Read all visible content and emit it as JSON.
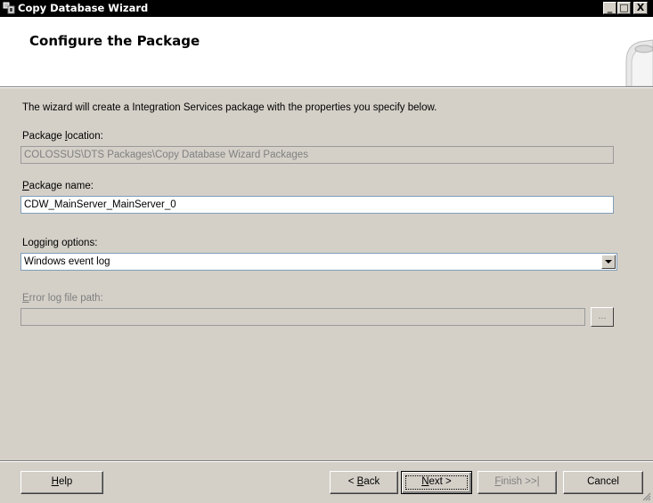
{
  "window": {
    "title": "Copy Database Wizard"
  },
  "caption_buttons": {
    "minimize": "_",
    "maximize": "□",
    "close": "X"
  },
  "header": {
    "title": "Configure the Package"
  },
  "intro": "The wizard will create a Integration Services package with the properties you specify below.",
  "package_location": {
    "label_pre": "Package ",
    "label_key": "l",
    "label_post": "ocation:",
    "value": "COLOSSUS\\DTS Packages\\Copy Database Wizard Packages"
  },
  "package_name": {
    "label_key": "P",
    "label_post": "ackage name:",
    "value": "CDW_MainServer_MainServer_0"
  },
  "logging": {
    "label": "Logging options:",
    "selected": "Windows event log"
  },
  "error_log": {
    "label_key": "E",
    "label_post": "rror log file path:",
    "value": "",
    "browse_label": "..."
  },
  "buttons": {
    "help_key": "H",
    "help_post": "elp",
    "back_pre": "< ",
    "back_key": "B",
    "back_post": "ack",
    "next_key": "N",
    "next_post": "ext >",
    "finish_key": "F",
    "finish_post": "inish >>|",
    "cancel": "Cancel"
  }
}
